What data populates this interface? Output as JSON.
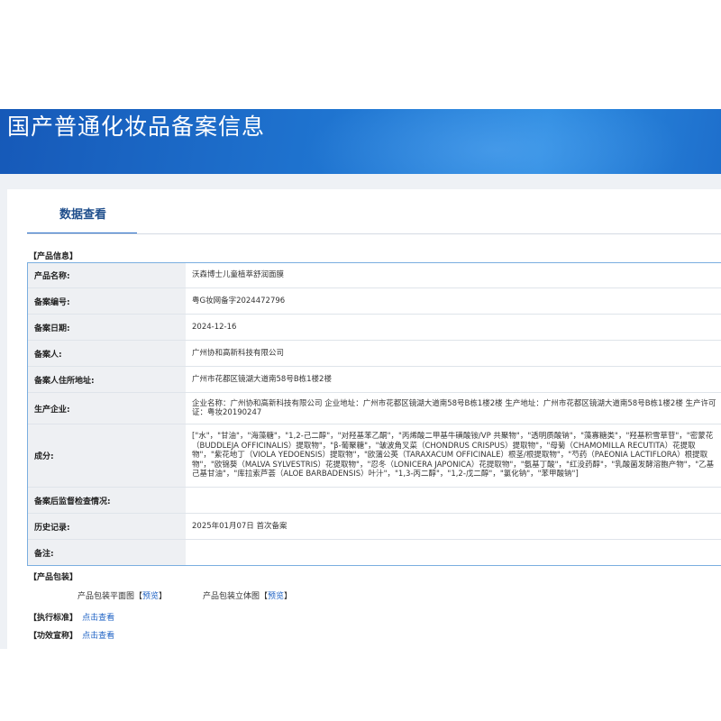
{
  "header": {
    "title": "国产普通化妆品备案信息"
  },
  "tabs": [
    {
      "label": "数据查看"
    }
  ],
  "product_info": {
    "section_title": "【产品信息】",
    "rows": [
      {
        "label": "产品名称:",
        "value": "沃森博士儿童植萃舒润面膜"
      },
      {
        "label": "备案编号:",
        "value": "粤G妆网备字2024472796"
      },
      {
        "label": "备案日期:",
        "value": "2024-12-16"
      },
      {
        "label": "备案人:",
        "value": "广州协和高新科技有限公司"
      },
      {
        "label": "备案人住所地址:",
        "value": "广州市花都区镜湖大道南58号B栋1楼2楼"
      },
      {
        "label": "生产企业:",
        "value": "企业名称：广州协和高新科技有限公司 企业地址：广州市花都区镜湖大道南58号B栋1楼2楼 生产地址：广州市花都区镜湖大道南58号B栋1楼2楼 生产许可证：粤妆20190247"
      },
      {
        "label": "成分:",
        "value": "[\"水\"，\"甘油\"，\"海藻糖\"，\"1,2-己二醇\"，\"对羟基苯乙酮\"，\"丙烯酸二甲基牛磺酸铵/VP 共聚物\"，\"透明质酸钠\"，\"藻寡糖类\"，\"羟基积雪草苷\"，\"密蒙花（BUDDLEJA OFFICINALIS）提取物\"，\"β-葡聚糖\"，\"皱波角叉菜（CHONDRUS CRISPUS）提取物\"，\"母菊（CHAMOMILLA RECUTITA）花提取物\"，\"紫花地丁（VIOLA YEDOENSIS）提取物\"，\"欧蒲公英（TARAXACUM OFFICINALE）根茎/根提取物\"，\"芍药（PAEONIA LACTIFLORA）根提取物\"，\"欧锦葵（MALVA SYLVESTRIS）花提取物\"，\"忍冬（LONICERA JAPONICA）花提取物\"，\"氨基丁酸\"，\"红没药醇\"，\"乳酸菌发酵溶胞产物\"，\"乙基己基甘油\"，\"库拉索芦荟（ALOE BARBADENSIS）叶汁\"，\"1,3-丙二醇\"，\"1,2-戊二醇\"，\"氯化钠\"，\"苯甲酸钠\"]"
      },
      {
        "label": "备案后监督检查情况:",
        "value": ""
      },
      {
        "label": "历史记录:",
        "value": "2025年01月07日 首次备案"
      },
      {
        "label": "备注:",
        "value": ""
      }
    ]
  },
  "packaging": {
    "section_title": "【产品包装】",
    "items": [
      {
        "label": "产品包装平面图",
        "link": "预览"
      },
      {
        "label": "产品包装立体图",
        "link": "预览"
      }
    ]
  },
  "standard": {
    "section_title": "【执行标准】",
    "link": "点击查看"
  },
  "efficacy": {
    "section_title": "【功效宣称】",
    "link": "点击查看"
  }
}
